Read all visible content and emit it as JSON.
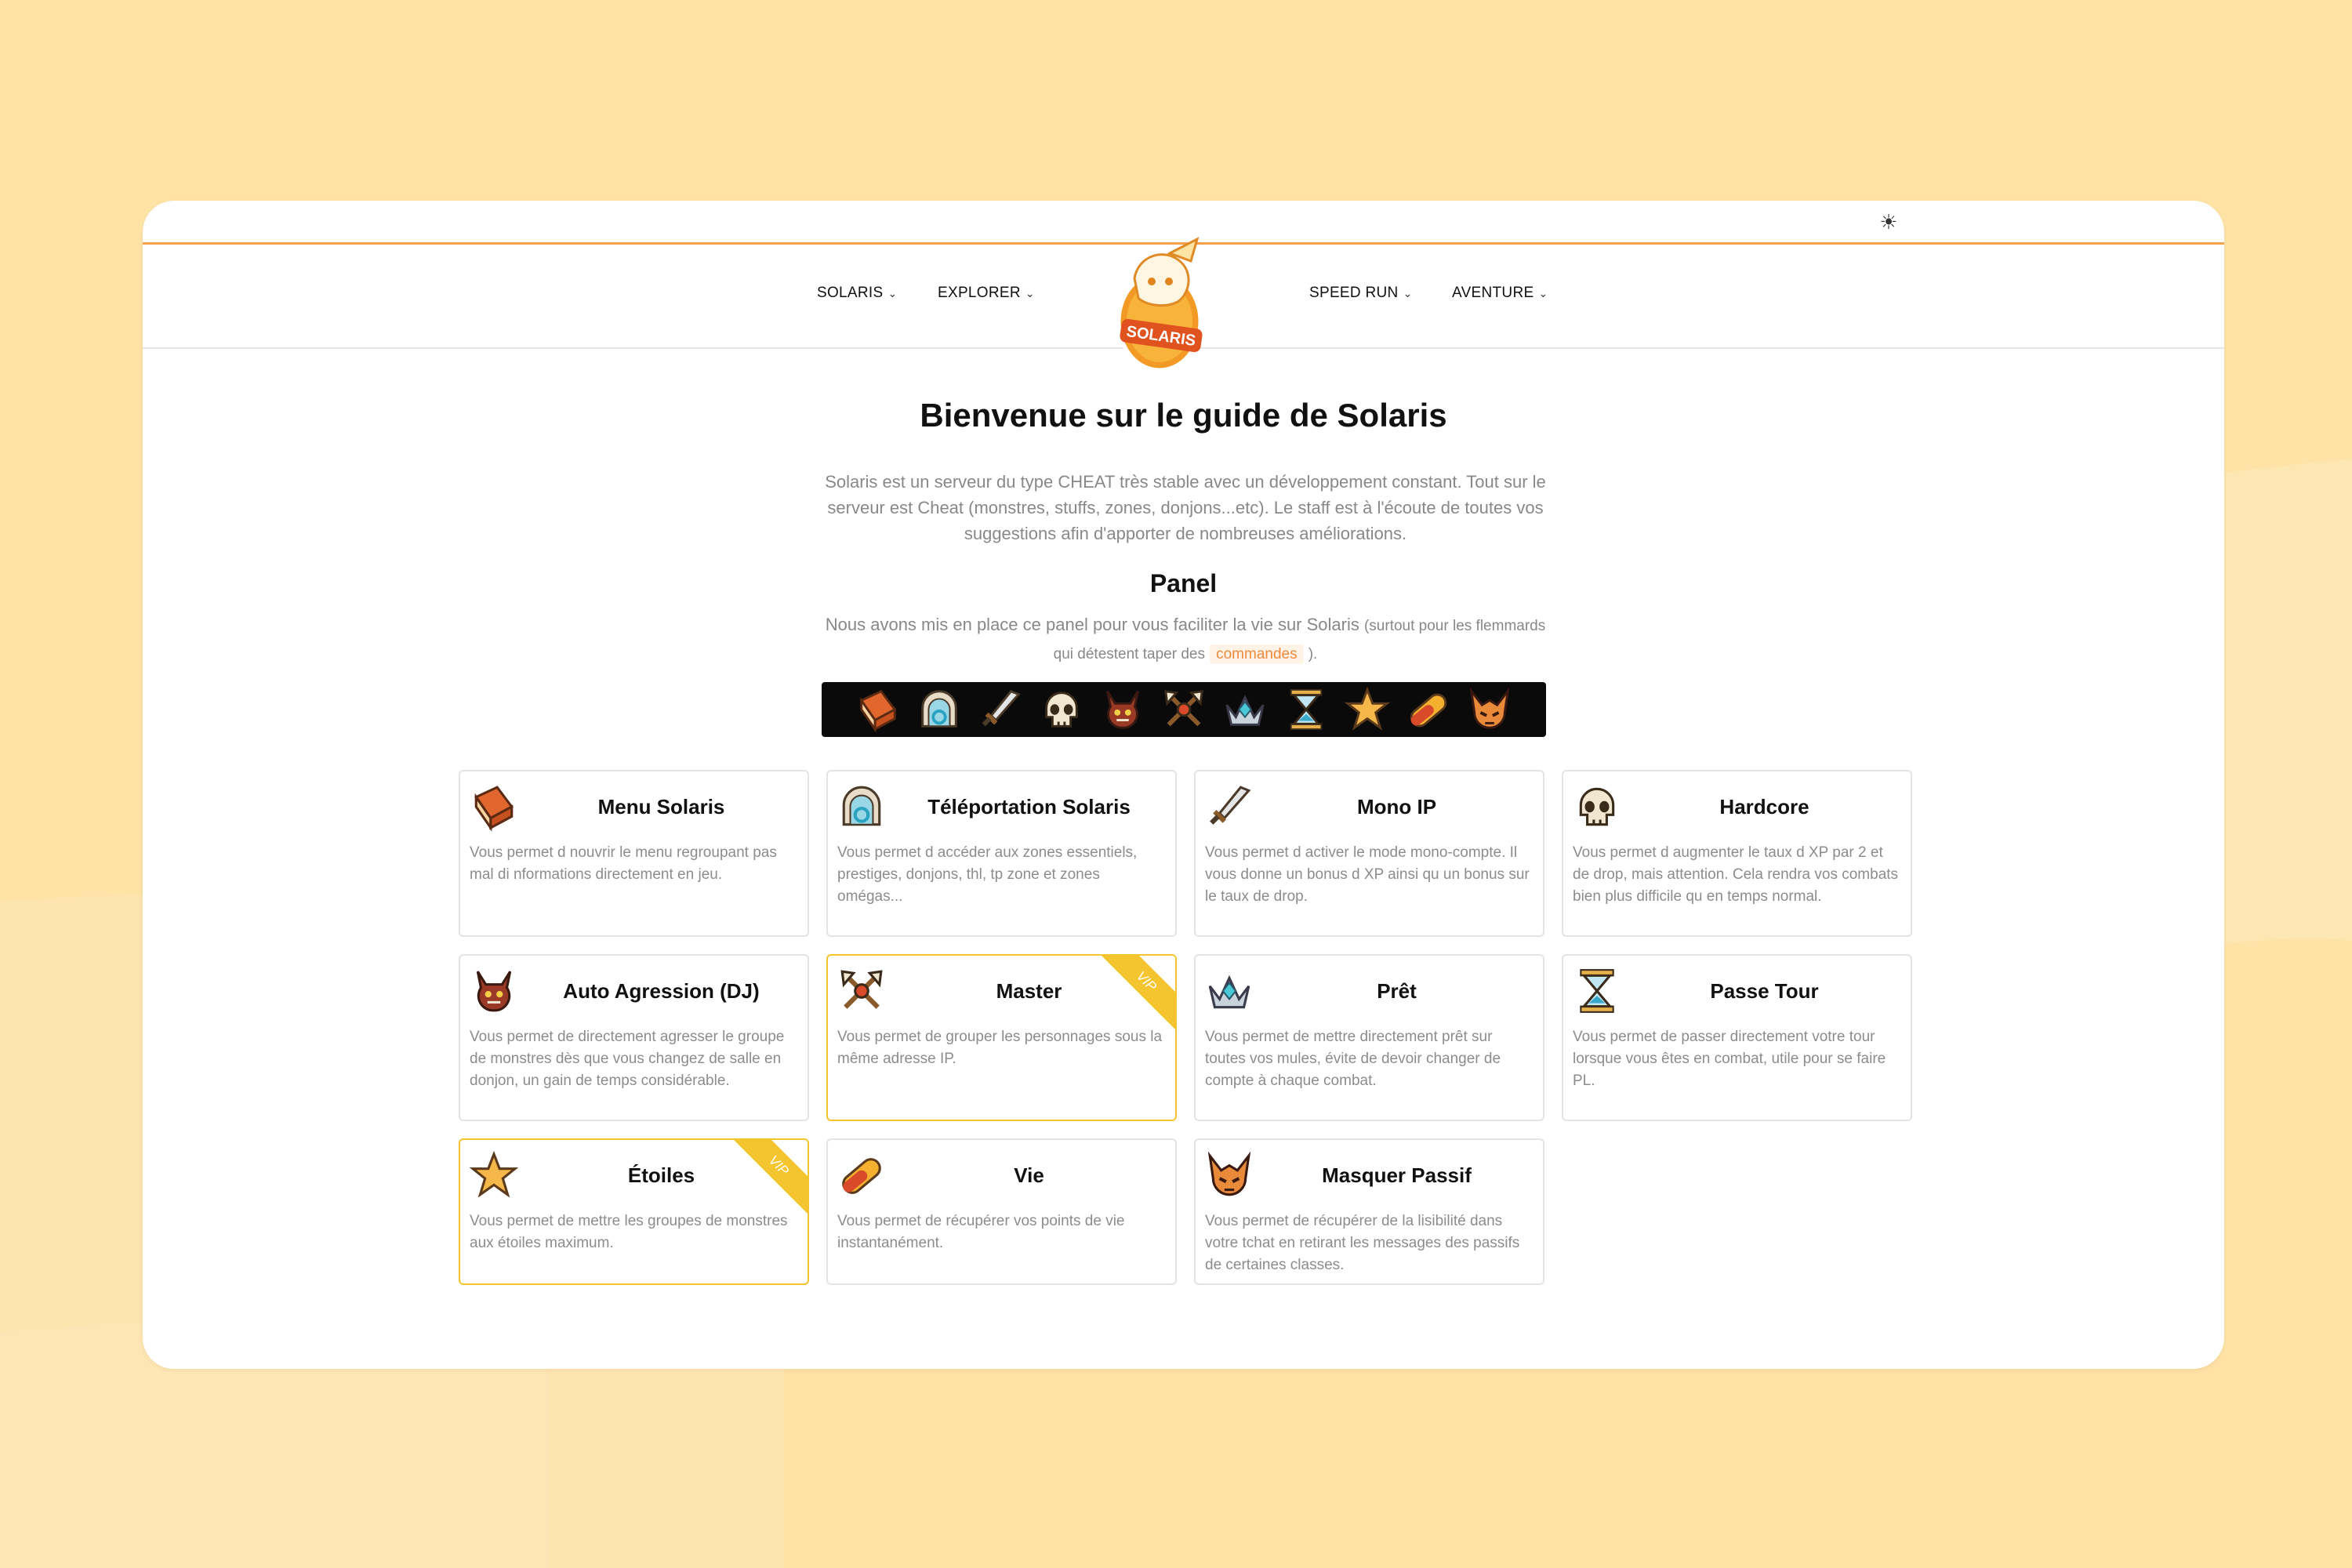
{
  "nav": {
    "left": [
      {
        "label": "SOLARIS"
      },
      {
        "label": "EXPLORER"
      }
    ],
    "right": [
      {
        "label": "SPEED RUN"
      },
      {
        "label": "AVENTURE"
      }
    ],
    "logo_text": "SOLARIS"
  },
  "theme_toggle_icon": "sun-icon",
  "main": {
    "title": "Bienvenue sur le guide de Solaris",
    "intro": "Solaris est un serveur du type CHEAT très stable avec un développement constant. Tout sur le serveur est Cheat (monstres, stuffs, zones, donjons...etc). Le staff est à l'écoute de toutes vos suggestions afin d'apporter de nombreuses améliorations.",
    "panel_title": "Panel",
    "panel_desc_main": "Nous avons mis en place ce panel pour vous faciliter la vie sur Solaris",
    "panel_desc_small_a": "(surtout pour les flemmards qui détestent taper des",
    "panel_desc_tag": "commandes",
    "panel_desc_small_b": ")."
  },
  "iconbar": [
    "book-icon",
    "portal-icon",
    "sword-icon",
    "skull-icon",
    "demon-icon",
    "crossed-axes-icon",
    "crown-icon",
    "hourglass-icon",
    "star-icon",
    "pill-icon",
    "mask-icon"
  ],
  "cards": [
    {
      "title": "Menu Solaris",
      "desc": "Vous permet d nouvrir le menu regroupant pas mal di nformations directement en jeu.",
      "icon": "book-icon",
      "vip": false
    },
    {
      "title": "Téléportation Solaris",
      "desc": "Vous permet d accéder aux zones essentiels, prestiges, donjons, thl, tp zone et zones omégas...",
      "icon": "portal-icon",
      "vip": false
    },
    {
      "title": "Mono IP",
      "desc": "Vous permet d activer le mode mono-compte. Il vous donne un bonus d XP ainsi qu un bonus sur le taux de drop.",
      "icon": "sword-icon",
      "vip": false
    },
    {
      "title": "Hardcore",
      "desc": "Vous permet d augmenter le taux d XP par 2 et de drop, mais attention. Cela rendra vos combats bien plus difficile qu en temps normal.",
      "icon": "skull-icon",
      "vip": false
    },
    {
      "title": "Auto Agression (DJ)",
      "desc": "Vous permet de directement agresser le groupe de monstres dès que vous changez de salle en donjon, un gain de temps considérable.",
      "icon": "demon-icon",
      "vip": false
    },
    {
      "title": "Master",
      "desc": "Vous permet de grouper les personnages sous la même adresse IP.",
      "icon": "crossed-axes-icon",
      "vip": true
    },
    {
      "title": "Prêt",
      "desc": "Vous permet de mettre directement prêt sur toutes vos mules, évite de devoir changer de compte à chaque combat.",
      "icon": "crown-icon",
      "vip": false
    },
    {
      "title": "Passe Tour",
      "desc": "Vous permet de passer directement votre tour lorsque vous êtes en combat, utile pour se faire PL.",
      "icon": "hourglass-icon",
      "vip": false
    },
    {
      "title": "Étoiles",
      "desc": "Vous permet de mettre les groupes de monstres aux étoiles maximum.",
      "icon": "star-icon",
      "vip": true
    },
    {
      "title": "Vie",
      "desc": "Vous permet de récupérer vos points de vie instantanément.",
      "icon": "pill-icon",
      "vip": false
    },
    {
      "title": "Masquer Passif",
      "desc": "Vous permet de récupérer de la lisibilité dans votre tchat en retirant les messages des passifs de certaines classes.",
      "icon": "mask-icon",
      "vip": false
    }
  ],
  "vip_label": "VIP",
  "colors": {
    "background": "#fee2a6",
    "accent": "#f5a04a",
    "vip": "#f5c530",
    "tag": "#f08a3c"
  }
}
